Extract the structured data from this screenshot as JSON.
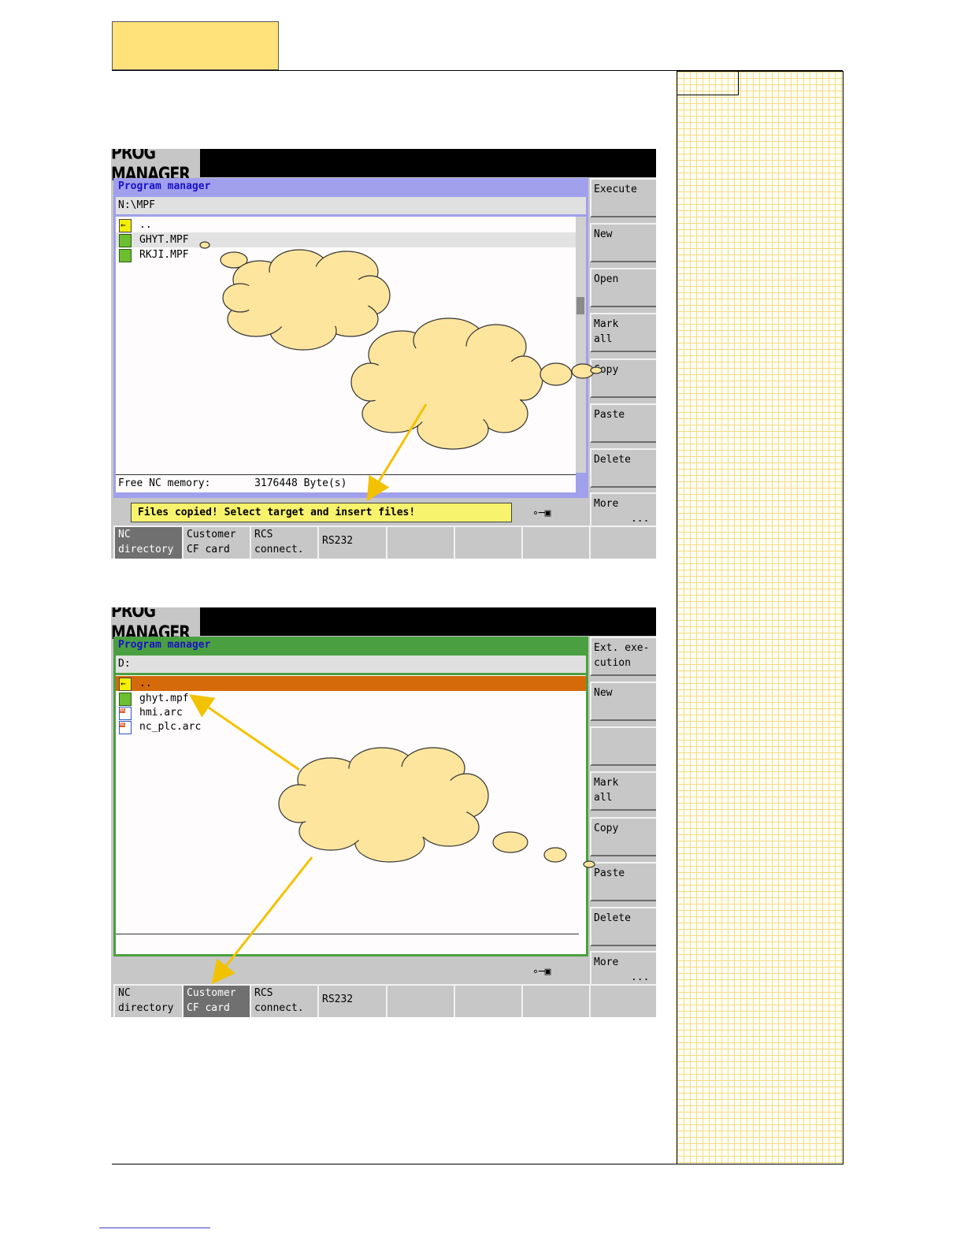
{
  "screens": [
    {
      "tab": "PROG MANAGER",
      "header": "Program manager",
      "header_color": "#1a10c8",
      "panel_color": "#a0a0ec",
      "path": "N:\\MPF",
      "files": [
        "..",
        "GHYT.MPF",
        "RKJI.MPF"
      ],
      "free_memory_label": "Free NC memory:",
      "free_memory_value": "3176448 Byte(s)",
      "status_message": "Files copied! Select target and insert files!",
      "vertical_softkeys": [
        "Execute",
        "New",
        "Open",
        "Mark\nall",
        "Copy",
        "Paste",
        "Delete",
        "More\n      ..."
      ],
      "horizontal_softkeys": [
        "NC\ndirectory",
        "Customer\nCF card",
        "RCS\nconnect.",
        "RS232",
        "",
        "",
        "",
        ""
      ],
      "active_hkey": 0
    },
    {
      "tab": "PROG MANAGER",
      "header": "Program manager",
      "header_color": "#1a10c8",
      "panel_color": "#4aa040",
      "path": "D:",
      "files": [
        "..",
        "ghyt.mpf",
        "hmi.arc",
        "nc_plc.arc"
      ],
      "status_message": "",
      "vertical_softkeys": [
        "Ext. exe-\ncution",
        "New",
        "",
        "Mark\nall",
        "Copy",
        "Paste",
        "Delete",
        "More\n      ..."
      ],
      "horizontal_softkeys": [
        "NC\ndirectory",
        "Customer\nCF card",
        "RCS\nconnect.",
        "RS232",
        "",
        "",
        "",
        ""
      ],
      "active_hkey": 1
    }
  ],
  "colors": {
    "callout_fill": "#fde59e",
    "arrow": "#f2c200",
    "selected_row": "#d56a0a"
  }
}
